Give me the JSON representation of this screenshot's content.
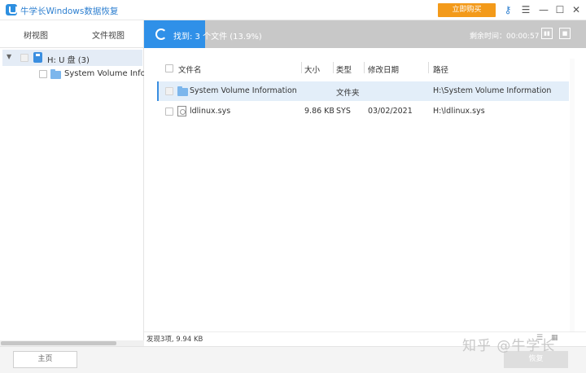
{
  "app": {
    "title": "牛学长Windows数据恢复",
    "buy_label": "立即购买"
  },
  "view_tabs": [
    "树视图",
    "文件视图"
  ],
  "tree": {
    "root_label": "H: U 盘 (3)",
    "child_label": "System Volume Information"
  },
  "progress": {
    "text": "找到: 3 个文件 (13.9%)",
    "percent": 13.9,
    "elapsed": "剩余时间：00:00:57",
    "pause_glyph": "▮▮",
    "stop_glyph": "■"
  },
  "table": {
    "columns": [
      "文件名",
      "大小",
      "类型",
      "修改日期",
      "路径"
    ],
    "rows": [
      {
        "name": "System Volume Information",
        "size": "",
        "type": "文件夹",
        "date": "",
        "path": "H:\\System Volume Information"
      },
      {
        "name": "ldlinux.sys",
        "size": "9.86 KB",
        "type": "SYS",
        "date": "03/02/2021",
        "path": "H:\\ldlinux.sys"
      }
    ]
  },
  "status": {
    "text": "发现3项, 9.94 KB"
  },
  "view_toggles": [
    "☰",
    "▦"
  ],
  "bottom": {
    "home_label": "主页",
    "recover_label": "恢复"
  },
  "watermark": "知乎 @牛学长",
  "colors": {
    "accent": "#2f90e8",
    "buy": "#f39a1a",
    "selection": "#e3eef9"
  },
  "icons": {
    "logo": "app-logo-icon",
    "key": "key-icon",
    "menu": "menu-icon",
    "minimize": "minimize-icon",
    "maximize": "maximize-icon",
    "close": "close-icon",
    "sync": "sync-icon",
    "usb": "usb-drive-icon",
    "folder": "folder-icon",
    "file": "file-icon"
  }
}
